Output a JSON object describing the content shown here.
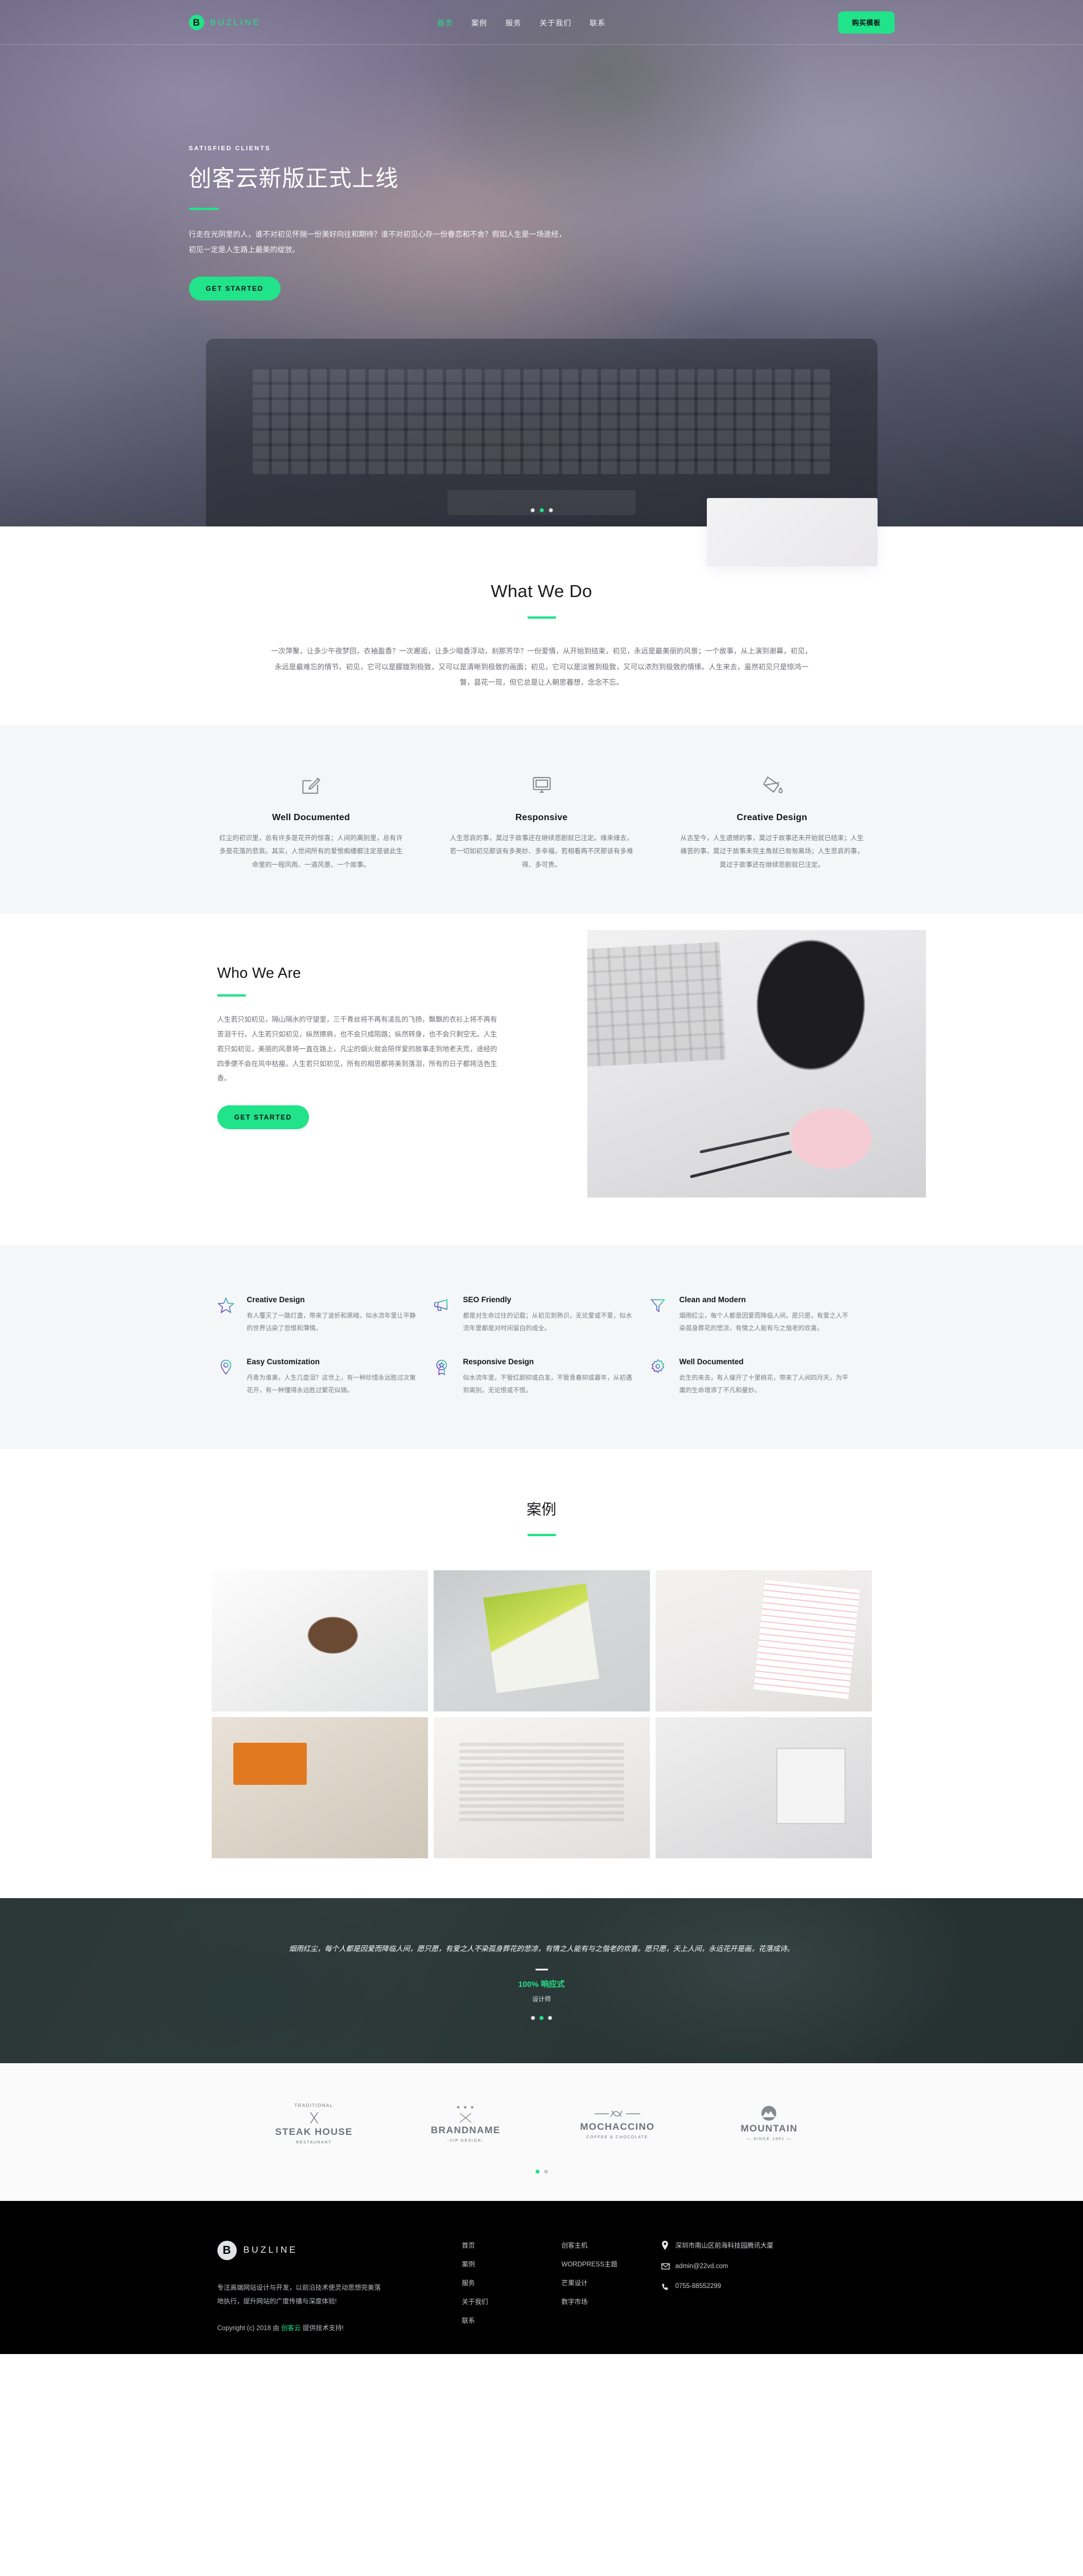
{
  "nav": {
    "brand_initial": "B",
    "brand_name": "BUZLINE",
    "links": [
      {
        "label": "首页",
        "active": true
      },
      {
        "label": "案例",
        "active": false
      },
      {
        "label": "服务",
        "active": false
      },
      {
        "label": "关于我们",
        "active": false
      },
      {
        "label": "联系",
        "active": false
      }
    ],
    "cta_label": "购买模板"
  },
  "hero": {
    "kicker": "SATISFIED CLIENTS",
    "title": "创客云新版正式上线",
    "text": "行走在光阴里的人，谁不对初见怀揣一份美好向往和期待？谁不对初见心存一份眷恋和不舍？假如人生是一场途经，初见一定是人生路上最美的绽放。",
    "button": "GET STARTED",
    "slide_count": 3,
    "active_slide": 2
  },
  "what_we_do": {
    "title": "What We Do",
    "lead": "一次萍聚，让多少午夜梦回，衣袖盈香？一次邂逅，让多少暗香浮动，刹那芳华？一份爱情，从开始到结束，初见，永远是最美丽的风景；一个故事，从上演到谢幕，初见，永远是最难忘的情节。初见，它可以是朦胧到极致，又可以是清晰到极致的画面；初见，它可以是淡雅到极致，又可以浓烈到极致的情愫。人生来去，虽然初见只是惊鸿一瞥，昙花一现，但它总是让人朝思暮想，念念不忘。"
  },
  "features3": [
    {
      "icon": "pencil-document-icon",
      "title": "Well Documented",
      "text": "红尘的初识里，总有许多是花开的惊喜；人间的离别里，总有许多是花落的悲哀。其实，人世间所有的爱恨痴缠都注定是彼此生命里的一程风雨、一道风景、一个故事。"
    },
    {
      "icon": "monitor-icon",
      "title": "Responsive",
      "text": "人生悲哀的事，莫过于故事还在继续悲剧就已注定。缘来缘去，若一切如初见那该有多美妙、多幸福，若相看两不厌那该有多难得、多可贵。"
    },
    {
      "icon": "paint-bucket-icon",
      "title": "Creative Design",
      "text": "从古至今，人生遗憾的事，莫过于故事还未开始就已结束；人生痛苦的事，莫过于故事未完主角就已匆匆离场；人生悲哀的事，莫过于故事还在继续悲剧就已注定。"
    }
  ],
  "who_we_are": {
    "title": "Who We Are",
    "text": "人生若只如初见，隔山隔水的守望里，三千青丝将不再有凌乱的飞扬，飘飘的衣衫上将不再有苦泪千行。人生若只如初见，纵然擦肩，也不会只成陌路；纵然转身，也不会只剩空无。人生若只如初见，美丽的风景将一直在路上，凡尘的烟火就会陪伴爱的故事走到地老天荒，途经的四季便不会在风中枯瘦。人生若只如初见，所有的相思都将美到落泪，所有的日子都将活色生香。",
    "button": "GET STARTED"
  },
  "features6": [
    {
      "icon": "star-icon",
      "title": "Creative Design",
      "text": "有人覆灭了一路灯盏，带来了波折和黑暗，似水流年里让平静的世界沾染了怨恨和薄情。"
    },
    {
      "icon": "megaphone-icon",
      "title": "SEO Friendly",
      "text": "都是对生命过往的记载；从初见到熟识，无论爱或不爱，似水流年里都是对时间留白的成全。"
    },
    {
      "icon": "funnel-icon",
      "title": "Clean and Modern",
      "text": "烟雨红尘，每个人都是因爱而降临人间，愿只愿，有爱之人不染孤身葬花的悲凉，有情之人能有与之偕老的欢喜。"
    },
    {
      "icon": "location-pin-icon",
      "title": "Easy Customization",
      "text": "丹青为谁美，人生几壶泪？这世上，有一种珍惜永远胜过次第花开，有一种懂得永远胜过繁花似锦。"
    },
    {
      "icon": "award-ribbon-icon",
      "title": "Responsive Design",
      "text": "似水流年里，不管红颜抑或白发，不管青春抑或暮年，从初遇到离别，无论恨或不恨。"
    },
    {
      "icon": "gear-icon",
      "title": "Well Documented",
      "text": "此生的来去，有人催开了十里桃花，带来了人间四月天，为平庸的生命增添了不凡和曼妙。"
    }
  ],
  "portfolio": {
    "title": "案例",
    "items": [
      {
        "name": "glasses-on-laptop"
      },
      {
        "name": "green-notebook-grid-paper"
      },
      {
        "name": "phone-and-dotted-notebook"
      },
      {
        "name": "tablet-with-croissant"
      },
      {
        "name": "open-book-with-highlighter"
      },
      {
        "name": "creative-mess-desk"
      }
    ]
  },
  "testimonial": {
    "quote": "烟雨红尘，每个人都是因爱而降临人间，愿只愿，有爱之人不染孤身葬花的悲凉，有情之人能有与之偕老的欢喜。愿只愿，天上人间，永远花开是画，花落成诗。",
    "name": "100% 响应式",
    "role": "设计师",
    "slide_count": 3,
    "active_slide": 2
  },
  "clients": {
    "logos": [
      {
        "top": "TRADITIONAL",
        "main": "STEAK HOUSE",
        "sub": "RESTAURANT",
        "icon": "fork-knife-icon"
      },
      {
        "top": "★ ★ ★",
        "main": "BRANDNAME",
        "sub": "-VIP DESIGN-",
        "icon": "arrows-badge-icon"
      },
      {
        "top": "",
        "main": "MOCHACCINO",
        "sub": "COFFEE & CHOCOLATE",
        "icon": "ribbon-swirl-icon"
      },
      {
        "top": "",
        "main": "MOUNTAIN",
        "sub": "— SINCE 1991 —",
        "icon": "mountain-icon"
      }
    ],
    "slide_count": 2,
    "active_slide": 1
  },
  "footer": {
    "brand_initial": "B",
    "brand_name": "BUZLINE",
    "description": "专注高端网站设计与开发，以前沿技术使灵动思想完美落地执行，提升网站的广度传播与深度体验!",
    "copyright_prefix": "Copyright (c) 2018 由 ",
    "copyright_link": "创客云",
    "copyright_suffix": " 提供技术支持!",
    "nav_column": [
      "首页",
      "案例",
      "服务",
      "关于我们",
      "联系"
    ],
    "links_column": [
      "创客主机",
      "WORDPRESS主题",
      "芒果设计",
      "数字市场"
    ],
    "contact": [
      {
        "icon": "location-pin-icon",
        "text": "深圳市南山区前海科技园腾讯大厦"
      },
      {
        "icon": "envelope-icon",
        "text": "admin@22vd.com"
      },
      {
        "icon": "phone-icon",
        "text": "0755-88552299"
      }
    ]
  },
  "colors": {
    "accent": "#21E38A",
    "dark": "#000000",
    "grey_bg": "#f5f6f7",
    "text": "#6f7178"
  }
}
